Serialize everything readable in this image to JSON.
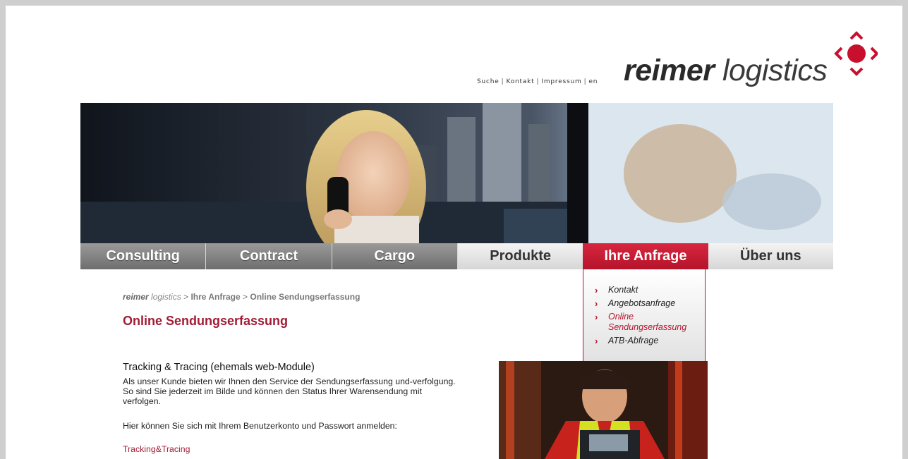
{
  "top_links": {
    "search": "Suche",
    "contact": "Kontakt",
    "imprint": "Impressum",
    "language": "en",
    "separator": "|"
  },
  "logo": {
    "bold": "reimer",
    "light": "logistics"
  },
  "nav": {
    "items": [
      {
        "label": "Consulting"
      },
      {
        "label": "Contract"
      },
      {
        "label": "Cargo"
      },
      {
        "label": "Produkte"
      },
      {
        "label": "Ihre Anfrage"
      },
      {
        "label": "Über uns"
      }
    ],
    "active_index": 4
  },
  "dropdown": {
    "items": [
      {
        "label": "Kontakt"
      },
      {
        "label": "Angebotsanfrage"
      },
      {
        "label": "Online Sendungserfassung"
      },
      {
        "label": "ATB-Abfrage"
      }
    ],
    "current_index": 2,
    "arrow": "›"
  },
  "breadcrumb": {
    "brand_bold": "reimer",
    "brand_light": "logistics",
    "separator": ">",
    "parent": "Ihre Anfrage",
    "current": "Online Sendungserfassung"
  },
  "content": {
    "title": "Online Sendungserfassung",
    "section_title": "Tracking & Tracing (ehemals web-Module)",
    "paragraph1": "Als unser Kunde bieten wir Ihnen den Service der Sendungserfassung und-verfolgung. So sind Sie jederzeit im Bilde und können den Status Ihrer Warensendung mit verfolgen.",
    "paragraph2": "Hier können Sie sich mit Ihrem Benutzerkonto und Passwort anmelden:",
    "link": "Tracking&Tracing"
  },
  "colors": {
    "accent": "#b5142b",
    "title": "#a11c35",
    "nav_dark": "#7d7d7d",
    "nav_light": "#e6e6e6"
  },
  "icons": {
    "logo_mark": "red-dot-with-arrows-icon"
  }
}
